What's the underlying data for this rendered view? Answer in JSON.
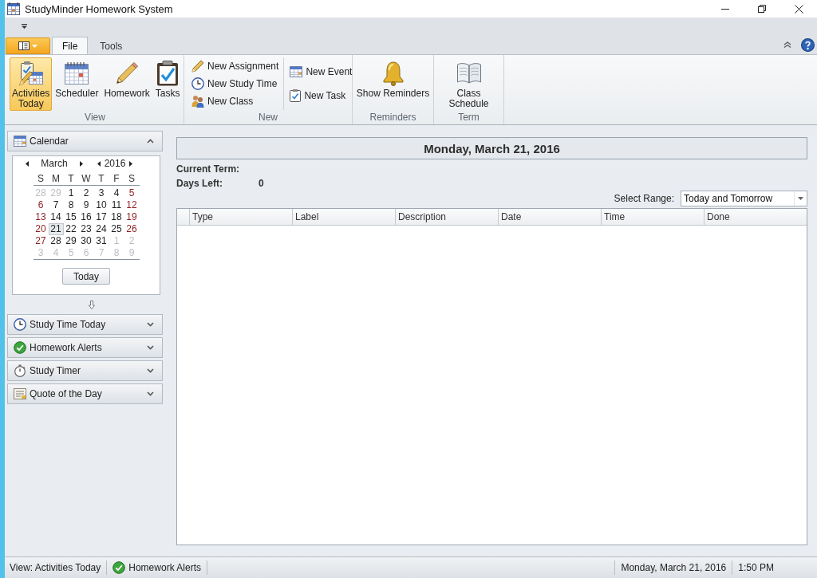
{
  "window": {
    "title": "StudyMinder Homework System"
  },
  "ribbon": {
    "tabs": [
      {
        "label": "File",
        "selected": true
      },
      {
        "label": "Tools",
        "selected": false
      }
    ],
    "groups": [
      {
        "label": "View",
        "kind": "large",
        "items": [
          {
            "label": "Activities Today",
            "selected": true
          },
          {
            "label": "Scheduler",
            "selected": false
          },
          {
            "label": "Homework",
            "selected": false
          },
          {
            "label": "Tasks",
            "selected": false
          }
        ]
      },
      {
        "label": "New",
        "kind": "small",
        "columns": [
          {
            "items": [
              {
                "label": "New Assignment"
              },
              {
                "label": "New Study Time"
              },
              {
                "label": "New Class"
              }
            ]
          },
          {
            "items": [
              {
                "label": "New Event"
              },
              {
                "label": "New Task"
              }
            ]
          }
        ]
      },
      {
        "label": "Reminders",
        "kind": "large",
        "items": [
          {
            "label": "Show Reminders",
            "selected": false
          }
        ]
      },
      {
        "label": "Term",
        "kind": "large",
        "items": [
          {
            "label": "Class Schedule",
            "selected": false
          }
        ]
      }
    ]
  },
  "sidebar": {
    "panels": [
      {
        "title": "Calendar",
        "expanded": true,
        "calendar": {
          "month": "March",
          "year": "2016",
          "weekdays": [
            "S",
            "M",
            "T",
            "W",
            "T",
            "F",
            "S"
          ],
          "weeks": [
            [
              {
                "day": "28",
                "kind": "other",
                "selected": false
              },
              {
                "day": "29",
                "kind": "other",
                "selected": false
              },
              {
                "day": "1",
                "kind": "day",
                "selected": false
              },
              {
                "day": "2",
                "kind": "day",
                "selected": false
              },
              {
                "day": "3",
                "kind": "day",
                "selected": false
              },
              {
                "day": "4",
                "kind": "day",
                "selected": false
              },
              {
                "day": "5",
                "kind": "weekend",
                "selected": false
              }
            ],
            [
              {
                "day": "6",
                "kind": "weekend",
                "selected": false
              },
              {
                "day": "7",
                "kind": "day",
                "selected": false
              },
              {
                "day": "8",
                "kind": "day",
                "selected": false
              },
              {
                "day": "9",
                "kind": "day",
                "selected": false
              },
              {
                "day": "10",
                "kind": "day",
                "selected": false
              },
              {
                "day": "11",
                "kind": "day",
                "selected": false
              },
              {
                "day": "12",
                "kind": "weekend",
                "selected": false
              }
            ],
            [
              {
                "day": "13",
                "kind": "weekend",
                "selected": false
              },
              {
                "day": "14",
                "kind": "day",
                "selected": false
              },
              {
                "day": "15",
                "kind": "day",
                "selected": false
              },
              {
                "day": "16",
                "kind": "day",
                "selected": false
              },
              {
                "day": "17",
                "kind": "day",
                "selected": false
              },
              {
                "day": "18",
                "kind": "day",
                "selected": false
              },
              {
                "day": "19",
                "kind": "weekend",
                "selected": false
              }
            ],
            [
              {
                "day": "20",
                "kind": "weekend",
                "selected": false
              },
              {
                "day": "21",
                "kind": "day",
                "selected": true
              },
              {
                "day": "22",
                "kind": "day",
                "selected": false
              },
              {
                "day": "23",
                "kind": "day",
                "selected": false
              },
              {
                "day": "24",
                "kind": "day",
                "selected": false
              },
              {
                "day": "25",
                "kind": "day",
                "selected": false
              },
              {
                "day": "26",
                "kind": "weekend",
                "selected": false
              }
            ],
            [
              {
                "day": "27",
                "kind": "weekend",
                "selected": false
              },
              {
                "day": "28",
                "kind": "day",
                "selected": false
              },
              {
                "day": "29",
                "kind": "day",
                "selected": false
              },
              {
                "day": "30",
                "kind": "day",
                "selected": false
              },
              {
                "day": "31",
                "kind": "day",
                "selected": false
              },
              {
                "day": "1",
                "kind": "other",
                "selected": false
              },
              {
                "day": "2",
                "kind": "other",
                "selected": false
              }
            ],
            [
              {
                "day": "3",
                "kind": "other",
                "selected": false
              },
              {
                "day": "4",
                "kind": "other",
                "selected": false
              },
              {
                "day": "5",
                "kind": "other",
                "selected": false
              },
              {
                "day": "6",
                "kind": "other",
                "selected": false
              },
              {
                "day": "7",
                "kind": "other",
                "selected": false
              },
              {
                "day": "8",
                "kind": "other",
                "selected": false
              },
              {
                "day": "9",
                "kind": "other",
                "selected": false
              }
            ]
          ],
          "today_button": "Today"
        }
      },
      {
        "title": "Study Time Today",
        "expanded": false
      },
      {
        "title": "Homework Alerts",
        "expanded": false
      },
      {
        "title": "Study Timer",
        "expanded": false
      },
      {
        "title": "Quote of the Day",
        "expanded": false
      }
    ]
  },
  "main": {
    "date_heading": "Monday, March 21, 2016",
    "info": [
      {
        "label": "Current Term:"
      },
      {
        "label": "Days Left:",
        "value": "0"
      }
    ],
    "range": {
      "label": "Select Range:",
      "value": "Today and Tomorrow"
    },
    "table": {
      "columns": [
        "Type",
        "Label",
        "Description",
        "Date",
        "Time",
        "Done"
      ]
    }
  },
  "status_bar": {
    "left": [
      {
        "kind": "text",
        "text": "View: Activities Today"
      },
      {
        "kind": "alert",
        "text": "Homework Alerts"
      }
    ],
    "right": [
      "Monday, March 21, 2016",
      "1:50 PM"
    ]
  }
}
